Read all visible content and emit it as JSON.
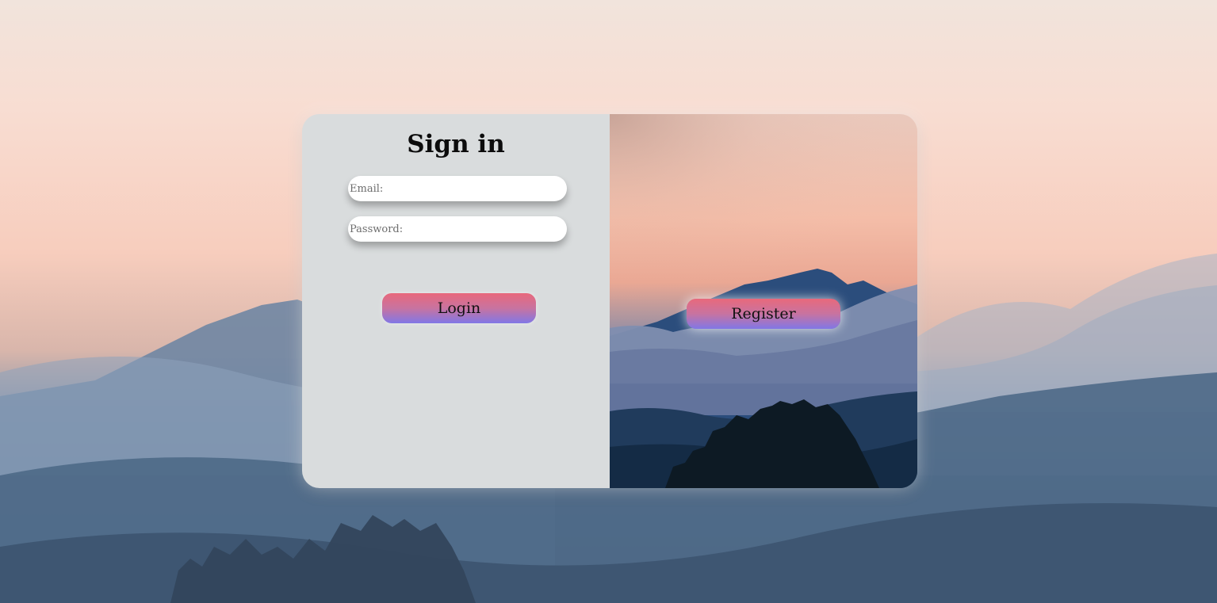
{
  "signin": {
    "title": "Sign in",
    "email_placeholder": "Email:",
    "password_placeholder": "Password:",
    "login_label": "Login"
  },
  "register": {
    "label": "Register"
  },
  "colors": {
    "button_gradient_top": "#e8697c",
    "button_gradient_bottom": "#8177e6",
    "panel_background": "#d9dcdd"
  }
}
